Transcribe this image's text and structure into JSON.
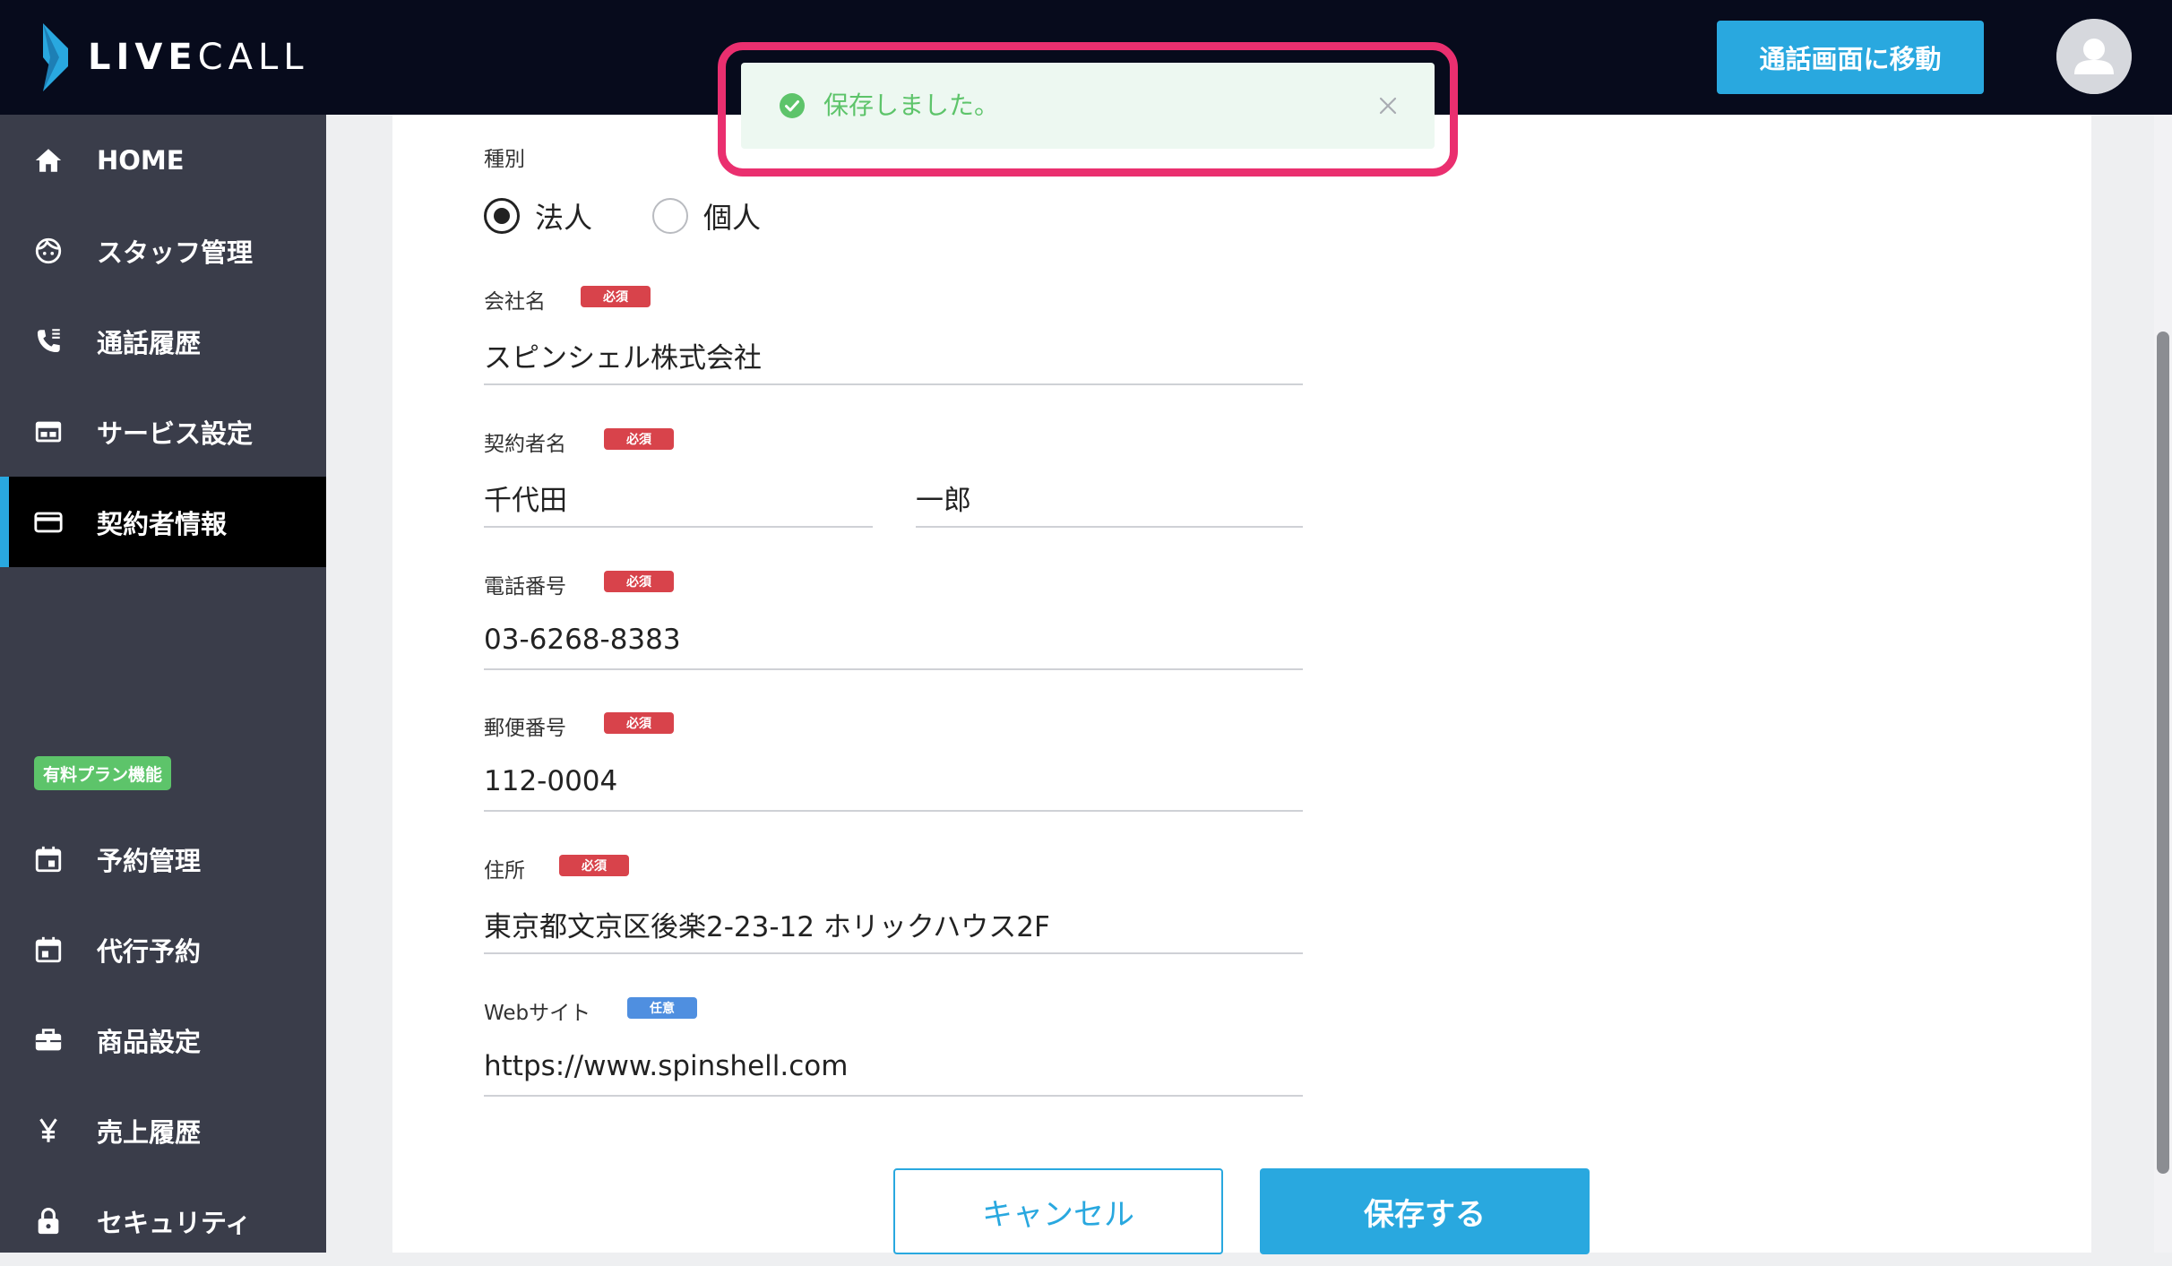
{
  "header": {
    "logo_live": "LIVE",
    "logo_call": "CALL",
    "goto_call_label": "通話画面に移動"
  },
  "sidebar": {
    "items": [
      {
        "label": "HOME",
        "icon": "home-icon"
      },
      {
        "label": "スタッフ管理",
        "icon": "staff-face-icon"
      },
      {
        "label": "通話履歴",
        "icon": "phone-icon"
      },
      {
        "label": "サービス設定",
        "icon": "service-window-icon"
      },
      {
        "label": "契約者情報",
        "icon": "card-icon",
        "active": true
      },
      {
        "label": "予約管理",
        "icon": "calendar-icon"
      },
      {
        "label": "代行予約",
        "icon": "calendar-icon"
      },
      {
        "label": "商品設定",
        "icon": "briefcase-icon"
      },
      {
        "label": "売上履歴",
        "icon": "yen-icon"
      },
      {
        "label": "セキュリティ",
        "icon": "lock-icon"
      }
    ],
    "plan_badge": "有料プラン機能"
  },
  "toast": {
    "message": "保存しました。",
    "icon": "check-circle-icon"
  },
  "form": {
    "type_label": "種別",
    "type_options": [
      {
        "label": "法人",
        "checked": true
      },
      {
        "label": "個人",
        "checked": false
      }
    ],
    "required_badge": "必須",
    "optional_badge": "任意",
    "company": {
      "label": "会社名",
      "value": "スピンシェル株式会社"
    },
    "contractor": {
      "label": "契約者名",
      "last_name": "千代田",
      "first_name": "一郎"
    },
    "phone": {
      "label": "電話番号",
      "value": "03-6268-8383"
    },
    "postal": {
      "label": "郵便番号",
      "value": "112-0004"
    },
    "address": {
      "label": "住所",
      "value": "東京都文京区後楽2-23-12 ホリックハウス2F"
    },
    "website": {
      "label": "Webサイト",
      "value": "https://www.spinshell.com"
    },
    "cancel_label": "キャンセル",
    "save_label": "保存する"
  },
  "colors": {
    "header_bg": "#070b1c",
    "sidebar_bg": "#3a3d4a",
    "accent": "#29a8df",
    "required": "#d8434b",
    "optional": "#4f8fe0",
    "success": "#5dc46a",
    "highlight": "#ea2f6f"
  }
}
